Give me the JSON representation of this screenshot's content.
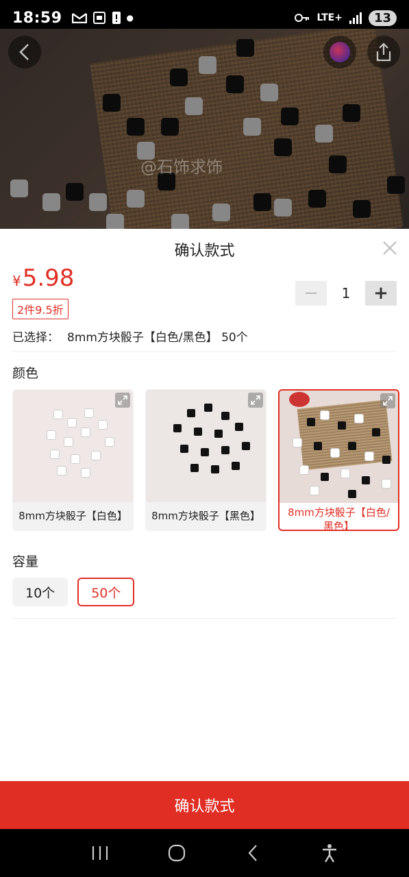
{
  "status_bar": {
    "time": "18:59",
    "network": "LTE+",
    "badge": "13"
  },
  "sheet": {
    "title": "确认款式",
    "price_symbol": "¥",
    "price_value": "5.98",
    "promo": "2件9.5折",
    "quantity": "1",
    "selected_label": "已选择：",
    "selected_value": "8mm方块骰子【白色/黑色】 50个",
    "color_section_label": "颜色",
    "colors": [
      {
        "label": "8mm方块骰子【白色】",
        "selected": false
      },
      {
        "label": "8mm方块骰子【黑色】",
        "selected": false
      },
      {
        "label": "8mm方块骰子【白色/黑色】",
        "selected": true
      }
    ],
    "capacity_section_label": "容量",
    "capacities": [
      {
        "label": "10个",
        "selected": false
      },
      {
        "label": "50个",
        "selected": true
      }
    ],
    "confirm_label": "确认款式"
  },
  "hero": {
    "watermark": "@石饰求饰"
  },
  "theme": {
    "accent": "#e02e24",
    "chip_bg": "#f2f2f2"
  }
}
